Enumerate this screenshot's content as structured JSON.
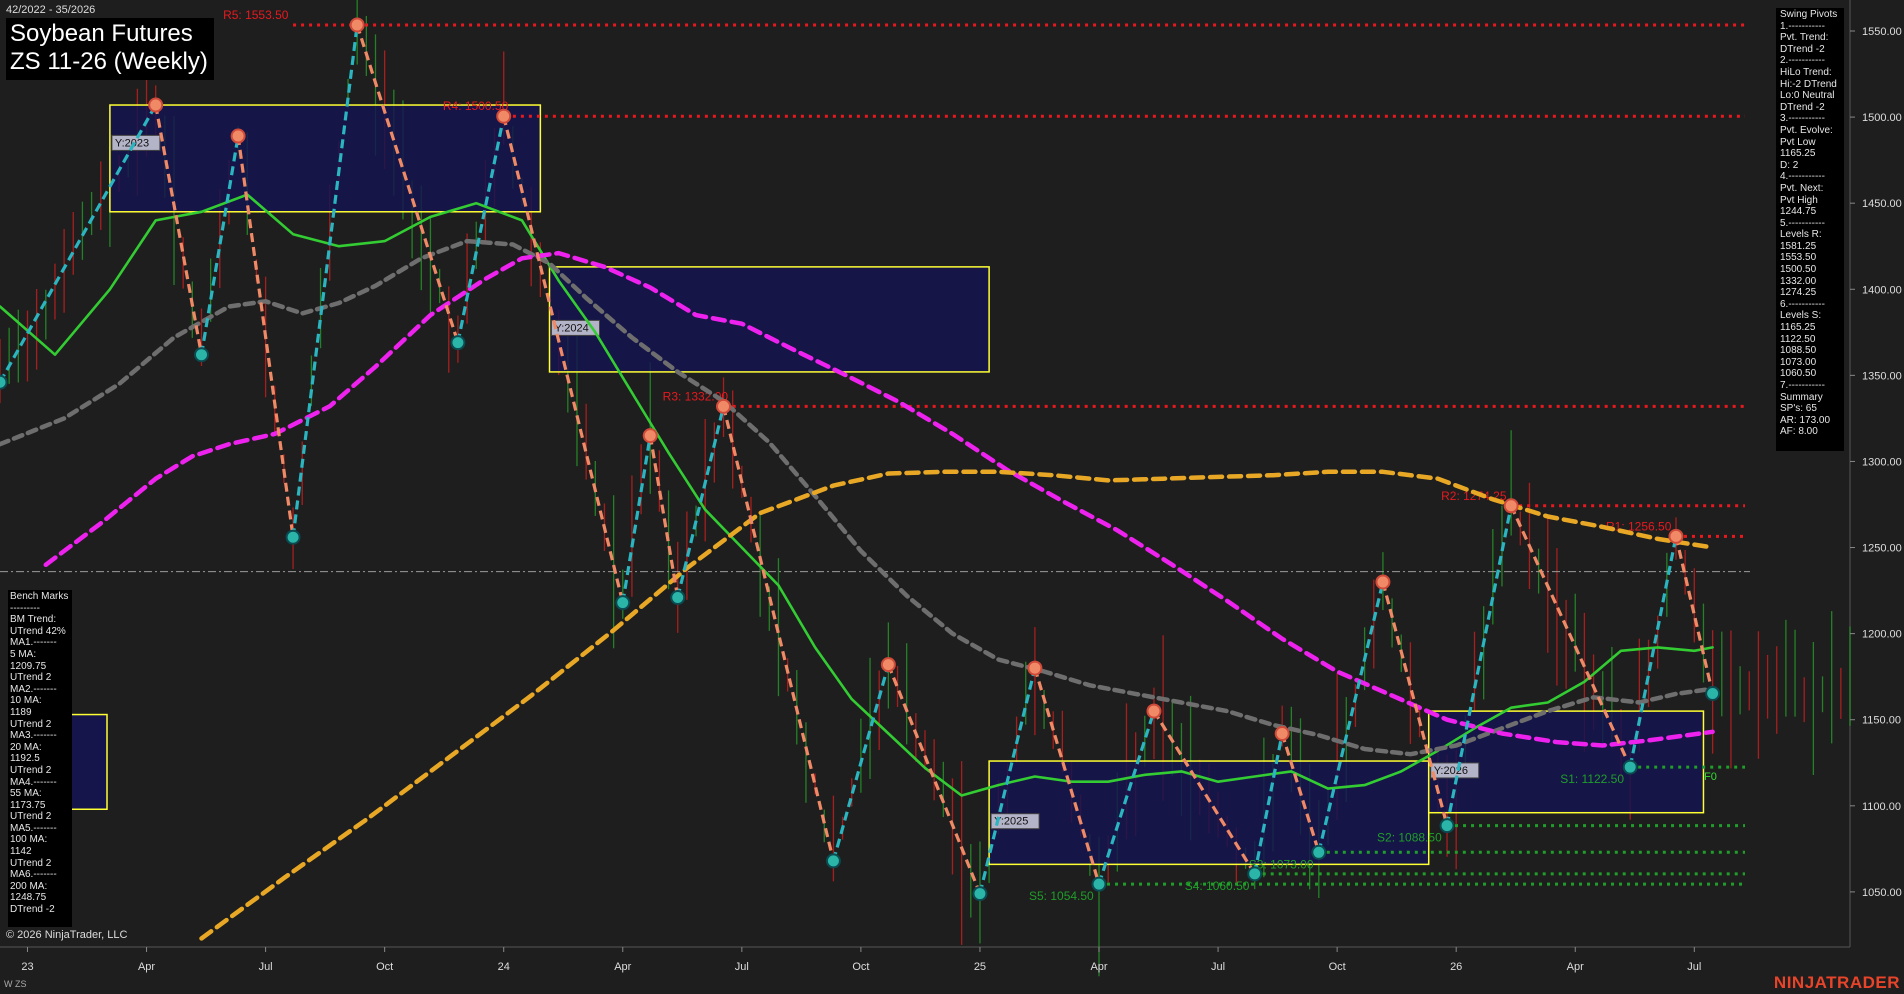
{
  "header": {
    "title_line1": "Soybean Futures",
    "title_line2": "ZS 11-26 (Weekly)",
    "date_range": "42/2022 - 35/2026"
  },
  "footer": {
    "copyright": "© 2026 NinjaTrader, LLC",
    "instrument": "W ZS",
    "brand": "NINJATRADER"
  },
  "swing_panel": [
    "Swing Pivots",
    "1.-----------",
    "Pvt. Trend:",
    "DTrend -2",
    "2.-----------",
    "HiLo Trend:",
    "Hi:-2 DTrend",
    "Lo:0 Neutral",
    "DTrend -2",
    "3.-----------",
    "Pvt. Evolve:",
    "Pvt Low",
    "1165.25",
    "D: 2",
    "4.-----------",
    "Pvt. Next:",
    "Pvt High",
    "1244.75",
    "5.-----------",
    "Levels R:",
    "1581.25",
    "1553.50",
    "1500.50",
    "1332.00",
    "1274.25",
    "6.-----------",
    "Levels S:",
    "1165.25",
    "1122.50",
    "1088.50",
    "1073.00",
    "1060.50",
    "7.-----------",
    "Summary",
    "SP's: 65",
    "AR: 173.00",
    "AF: 8.00"
  ],
  "bench_panel": [
    "Bench Marks",
    "---------",
    "BM Trend:",
    "UTrend 42%",
    "MA1.-------",
    "5 MA:",
    "1209.75",
    "UTrend 2",
    "MA2.-------",
    "10 MA:",
    "1189",
    "UTrend 2",
    "MA3.-------",
    "20 MA:",
    "1192.5",
    "UTrend 2",
    "MA4.-------",
    "55 MA:",
    "1173.75",
    "UTrend 2",
    "MA5.-------",
    "100 MA:",
    "1142",
    "UTrend 2",
    "MA6.-------",
    "200 MA:",
    "1248.75",
    "DTrend -2"
  ],
  "colors": {
    "background": "#1e1e1e",
    "resistance": "#e8191e",
    "support": "#1f9e2a",
    "ma_green": "#33cc33",
    "ma_gray": "#6e6e6e",
    "ma_magenta": "#ee22ee",
    "ma_orange": "#e8a826",
    "swing_up": "#2ab5c0",
    "swing_down": "#f08a66",
    "year_box_fill": "#141450",
    "year_box_border": "#ffff33"
  },
  "chart_data": {
    "type": "line",
    "x_axis_labels": [
      "23",
      "Apr",
      "Jul",
      "Oct",
      "24",
      "Apr",
      "Jul",
      "Oct",
      "25",
      "Apr",
      "Jul",
      "Oct",
      "26",
      "Apr",
      "Jul"
    ],
    "y_ticks": [
      1050.0,
      1100.0,
      1150.0,
      1200.0,
      1250.0,
      1300.0,
      1350.0,
      1400.0,
      1450.0,
      1500.0,
      1550.0
    ],
    "ylim": [
      1018,
      1568
    ],
    "x_range_weeks": [
      -3,
      199
    ],
    "resistance_levels": [
      {
        "label": "R5: 1553.50",
        "value": 1553.5,
        "start_week": 29
      },
      {
        "label": "R4: 1500.50",
        "value": 1500.5,
        "start_week": 53
      },
      {
        "label": "R3: 1332.00",
        "value": 1332.0,
        "start_week": 77
      },
      {
        "label": "R2: 1274.25",
        "value": 1274.25,
        "start_week": 162
      },
      {
        "label": "R1: 1256.50",
        "value": 1256.5,
        "start_week": 180
      }
    ],
    "support_levels": [
      {
        "label": "S1: 1122.50",
        "value": 1122.5,
        "start_week": 175
      },
      {
        "label": "S2: 1088.50",
        "value": 1088.5,
        "start_week": 155
      },
      {
        "label": "S3: 1073.00",
        "value": 1073.0,
        "start_week": 141
      },
      {
        "label": "S4: 1060.50",
        "value": 1060.5,
        "start_week": 134
      },
      {
        "label": "S5: 1054.50",
        "value": 1054.5,
        "start_week": 117
      }
    ],
    "fib_label": "F0",
    "current_price": 1236,
    "year_boxes": [
      {
        "label": "Y:2023",
        "start_week": 9,
        "end_week": 56,
        "high": 1507,
        "low": 1445
      },
      {
        "label": "Y:2024",
        "start_week": 57,
        "end_week": 105,
        "high": 1413,
        "low": 1352
      },
      {
        "label": "Y:2025",
        "start_week": 105,
        "end_week": 153,
        "high": 1126,
        "low": 1066
      },
      {
        "label": "Y:2026",
        "start_week": 153,
        "end_week": 183,
        "high": 1155,
        "low": 1096
      }
    ],
    "bench_box": {
      "high": 1153,
      "low": 1098
    },
    "swing_pivots": [
      {
        "week": -3,
        "price": 1346,
        "type": "low"
      },
      {
        "week": 14,
        "price": 1507,
        "type": "high"
      },
      {
        "week": 19,
        "price": 1362,
        "type": "low"
      },
      {
        "week": 23,
        "price": 1489,
        "type": "high"
      },
      {
        "week": 29,
        "price": 1256,
        "type": "low"
      },
      {
        "week": 36,
        "price": 1553.5,
        "type": "high"
      },
      {
        "week": 47,
        "price": 1369,
        "type": "low"
      },
      {
        "week": 52,
        "price": 1500.5,
        "type": "high"
      },
      {
        "week": 65,
        "price": 1218,
        "type": "low"
      },
      {
        "week": 68,
        "price": 1315,
        "type": "high"
      },
      {
        "week": 71,
        "price": 1221,
        "type": "low"
      },
      {
        "week": 76,
        "price": 1332,
        "type": "high"
      },
      {
        "week": 88,
        "price": 1068,
        "type": "low"
      },
      {
        "week": 94,
        "price": 1182,
        "type": "high"
      },
      {
        "week": 104,
        "price": 1049,
        "type": "low"
      },
      {
        "week": 110,
        "price": 1180,
        "type": "high"
      },
      {
        "week": 117,
        "price": 1054.5,
        "type": "low"
      },
      {
        "week": 123,
        "price": 1155,
        "type": "high"
      },
      {
        "week": 134,
        "price": 1060.5,
        "type": "low"
      },
      {
        "week": 137,
        "price": 1142,
        "type": "high"
      },
      {
        "week": 141,
        "price": 1073,
        "type": "low"
      },
      {
        "week": 148,
        "price": 1230,
        "type": "high"
      },
      {
        "week": 155,
        "price": 1088.5,
        "type": "low"
      },
      {
        "week": 162,
        "price": 1274.25,
        "type": "high"
      },
      {
        "week": 175,
        "price": 1122.5,
        "type": "low"
      },
      {
        "week": 180,
        "price": 1256.5,
        "type": "high"
      },
      {
        "week": 184,
        "price": 1165.25,
        "type": "low"
      }
    ],
    "series": [
      {
        "name": "5 MA",
        "color": "#33cc33",
        "style": "solid",
        "points": [
          [
            -3,
            1390
          ],
          [
            3,
            1362
          ],
          [
            9,
            1400
          ],
          [
            14,
            1440
          ],
          [
            19,
            1445
          ],
          [
            24,
            1455
          ],
          [
            29,
            1432
          ],
          [
            34,
            1425
          ],
          [
            39,
            1428
          ],
          [
            44,
            1442
          ],
          [
            49,
            1450
          ],
          [
            54,
            1440
          ],
          [
            58,
            1405
          ],
          [
            62,
            1375
          ],
          [
            66,
            1340
          ],
          [
            70,
            1305
          ],
          [
            74,
            1272
          ],
          [
            78,
            1250
          ],
          [
            82,
            1228
          ],
          [
            86,
            1192
          ],
          [
            90,
            1162
          ],
          [
            94,
            1142
          ],
          [
            98,
            1122
          ],
          [
            102,
            1106
          ],
          [
            106,
            1112
          ],
          [
            110,
            1117
          ],
          [
            114,
            1114
          ],
          [
            118,
            1114
          ],
          [
            122,
            1118
          ],
          [
            126,
            1120
          ],
          [
            130,
            1114
          ],
          [
            134,
            1117
          ],
          [
            138,
            1120
          ],
          [
            142,
            1110
          ],
          [
            146,
            1112
          ],
          [
            150,
            1120
          ],
          [
            154,
            1132
          ],
          [
            158,
            1145
          ],
          [
            162,
            1157
          ],
          [
            166,
            1160
          ],
          [
            170,
            1172
          ],
          [
            174,
            1190
          ],
          [
            178,
            1192
          ],
          [
            182,
            1190
          ],
          [
            184,
            1192
          ]
        ]
      },
      {
        "name": "20 MA",
        "color": "#6e6e6e",
        "style": "dashed",
        "points": [
          [
            -3,
            1310
          ],
          [
            4,
            1325
          ],
          [
            10,
            1345
          ],
          [
            16,
            1372
          ],
          [
            22,
            1390
          ],
          [
            26,
            1393
          ],
          [
            30,
            1386
          ],
          [
            34,
            1392
          ],
          [
            38,
            1402
          ],
          [
            43,
            1418
          ],
          [
            48,
            1428
          ],
          [
            53,
            1426
          ],
          [
            57,
            1415
          ],
          [
            61,
            1395
          ],
          [
            66,
            1372
          ],
          [
            71,
            1352
          ],
          [
            76,
            1335
          ],
          [
            81,
            1311
          ],
          [
            86,
            1280
          ],
          [
            91,
            1248
          ],
          [
            96,
            1222
          ],
          [
            101,
            1200
          ],
          [
            106,
            1185
          ],
          [
            111,
            1178
          ],
          [
            116,
            1170
          ],
          [
            121,
            1165
          ],
          [
            126,
            1160
          ],
          [
            131,
            1155
          ],
          [
            136,
            1147
          ],
          [
            141,
            1141
          ],
          [
            146,
            1133
          ],
          [
            151,
            1130
          ],
          [
            156,
            1135
          ],
          [
            161,
            1145
          ],
          [
            166,
            1155
          ],
          [
            171,
            1163
          ],
          [
            176,
            1160
          ],
          [
            180,
            1165
          ],
          [
            184,
            1168
          ]
        ]
      },
      {
        "name": "55 MA",
        "color": "#ee22ee",
        "style": "dashed",
        "points": [
          [
            2,
            1240
          ],
          [
            8,
            1264
          ],
          [
            14,
            1290
          ],
          [
            18,
            1303
          ],
          [
            22,
            1310
          ],
          [
            27,
            1316
          ],
          [
            33,
            1332
          ],
          [
            38,
            1355
          ],
          [
            44,
            1385
          ],
          [
            50,
            1406
          ],
          [
            54,
            1418
          ],
          [
            58,
            1421
          ],
          [
            63,
            1413
          ],
          [
            68,
            1401
          ],
          [
            73,
            1385
          ],
          [
            78,
            1380
          ],
          [
            84,
            1364
          ],
          [
            89,
            1351
          ],
          [
            95,
            1335
          ],
          [
            101,
            1316
          ],
          [
            107,
            1295
          ],
          [
            113,
            1277
          ],
          [
            119,
            1260
          ],
          [
            125,
            1240
          ],
          [
            131,
            1219
          ],
          [
            137,
            1197
          ],
          [
            143,
            1178
          ],
          [
            149,
            1164
          ],
          [
            155,
            1150
          ],
          [
            161,
            1142
          ],
          [
            167,
            1137
          ],
          [
            172,
            1135
          ],
          [
            177,
            1138
          ],
          [
            184,
            1143
          ]
        ]
      },
      {
        "name": "200 MA",
        "color": "#e8a826",
        "style": "dashed",
        "points": [
          [
            19,
            1023
          ],
          [
            28,
            1058
          ],
          [
            37,
            1092
          ],
          [
            46,
            1128
          ],
          [
            55,
            1164
          ],
          [
            64,
            1202
          ],
          [
            72,
            1238
          ],
          [
            80,
            1270
          ],
          [
            88,
            1286
          ],
          [
            94,
            1293
          ],
          [
            100,
            1294
          ],
          [
            106,
            1294
          ],
          [
            112,
            1292
          ],
          [
            118,
            1289
          ],
          [
            124,
            1290
          ],
          [
            130,
            1291
          ],
          [
            136,
            1292
          ],
          [
            142,
            1294
          ],
          [
            148,
            1294
          ],
          [
            154,
            1290
          ],
          [
            160,
            1278
          ],
          [
            166,
            1268
          ],
          [
            172,
            1262
          ],
          [
            178,
            1255
          ],
          [
            184,
            1250
          ]
        ]
      }
    ]
  }
}
